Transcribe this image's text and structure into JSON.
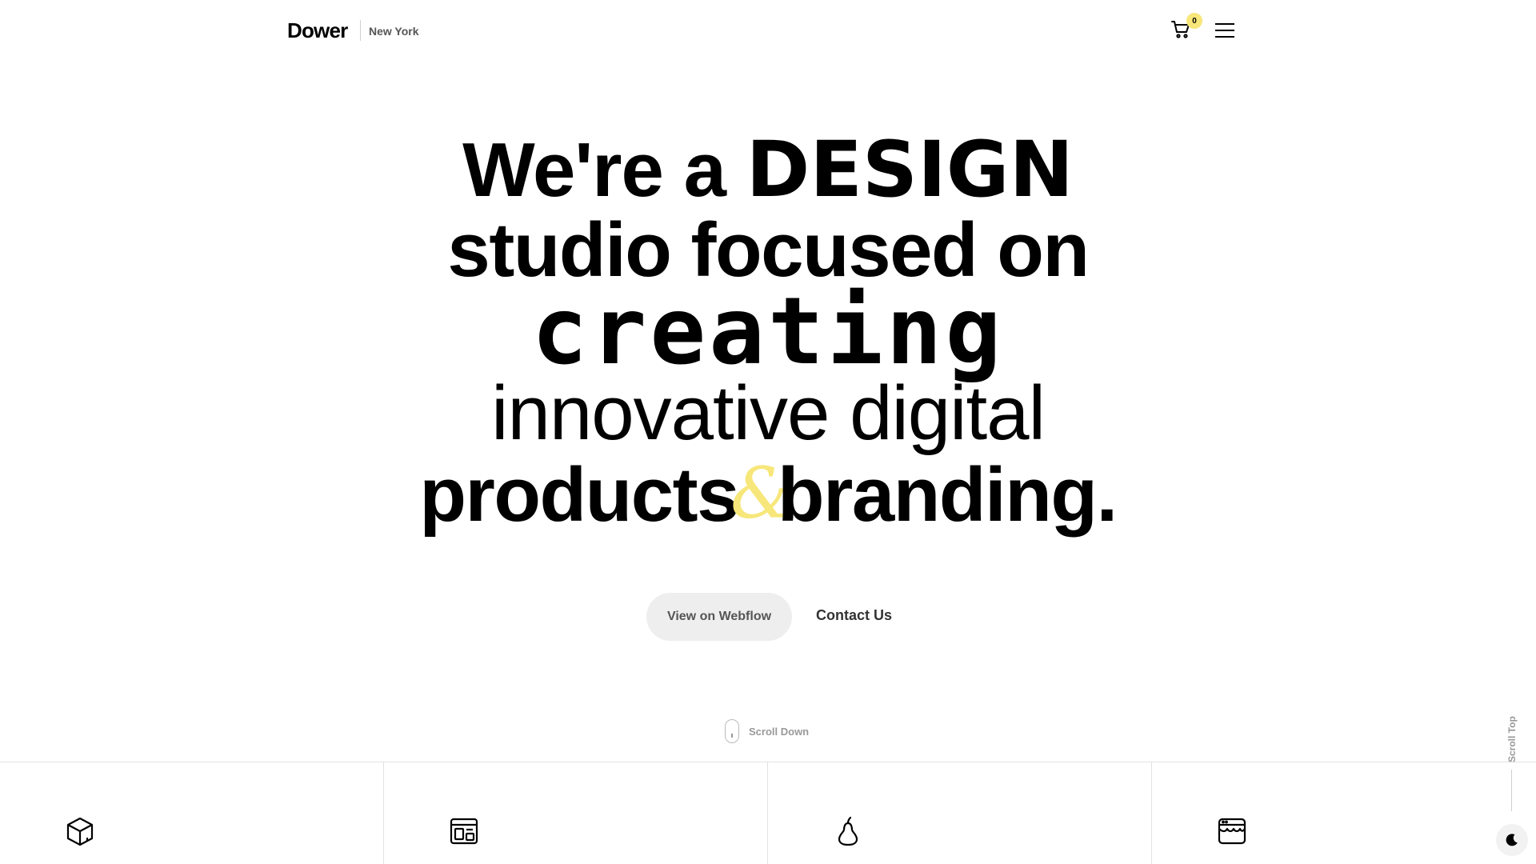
{
  "header": {
    "brand": "Dower",
    "city": "New York",
    "cart_count": "0"
  },
  "hero": {
    "line1_a": "We're a ",
    "line1_b": "DESIGN",
    "line2": "studio focused on",
    "line3": "creating",
    "line4": "innovative digital",
    "line5_a": "products",
    "line5_amp": "&",
    "line5_b": "branding."
  },
  "cta": {
    "webflow_label": "View on Webflow",
    "contact_label": "Contact Us"
  },
  "scroll": {
    "down_label": "Scroll Down",
    "top_label": "Scroll Top"
  },
  "features": {
    "icons": [
      "cube-icon",
      "layout-icon",
      "pear-icon",
      "store-icon"
    ]
  },
  "colors": {
    "accent": "#f7e77a",
    "text": "#000000",
    "muted": "#999999",
    "button_bg": "#eeeeee"
  }
}
